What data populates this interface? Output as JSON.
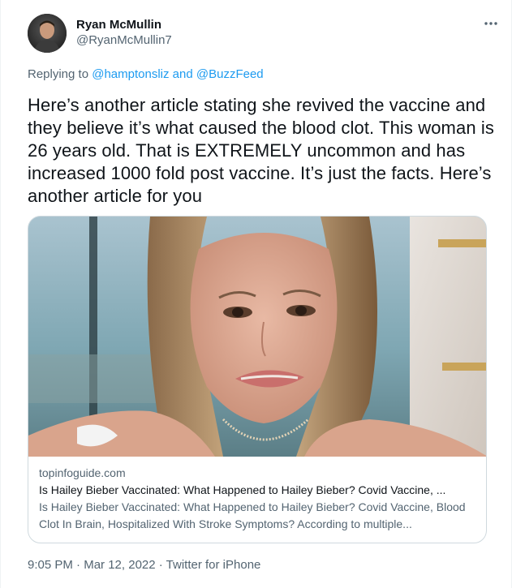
{
  "user": {
    "display_name": "Ryan McMullin",
    "handle": "@RyanMcMullin7"
  },
  "more_icon": "ellipsis-icon",
  "reply": {
    "prefix": "Replying to ",
    "mention1": "@hamptonsliz",
    "conjunction": " and ",
    "mention2": "@BuzzFeed"
  },
  "tweet_text": "Here’s another article stating she revived the vaccine and they believe it’s what caused the blood clot. This woman is 26 years old. That is EXTREMELY uncommon and has increased 1000 fold post vaccine. It’s just the facts. Here’s another article for you",
  "card": {
    "domain": "topinfoguide.com",
    "title": "Is Hailey Bieber Vaccinated: What Happened to Hailey Bieber? Covid Vaccine, ...",
    "description": "Is Hailey Bieber Vaccinated: What Happened to Hailey Bieber? Covid Vaccine, Blood Clot In Brain, Hospitalized With Stroke Symptoms? According to multiple..."
  },
  "meta": {
    "time": "9:05 PM",
    "separator": " · ",
    "date": "Mar 12, 2022",
    "source": "Twitter for iPhone"
  },
  "colors": {
    "accent": "#1d9bf0",
    "text": "#0f1419",
    "secondary": "#536471",
    "border": "#cfd9de"
  }
}
